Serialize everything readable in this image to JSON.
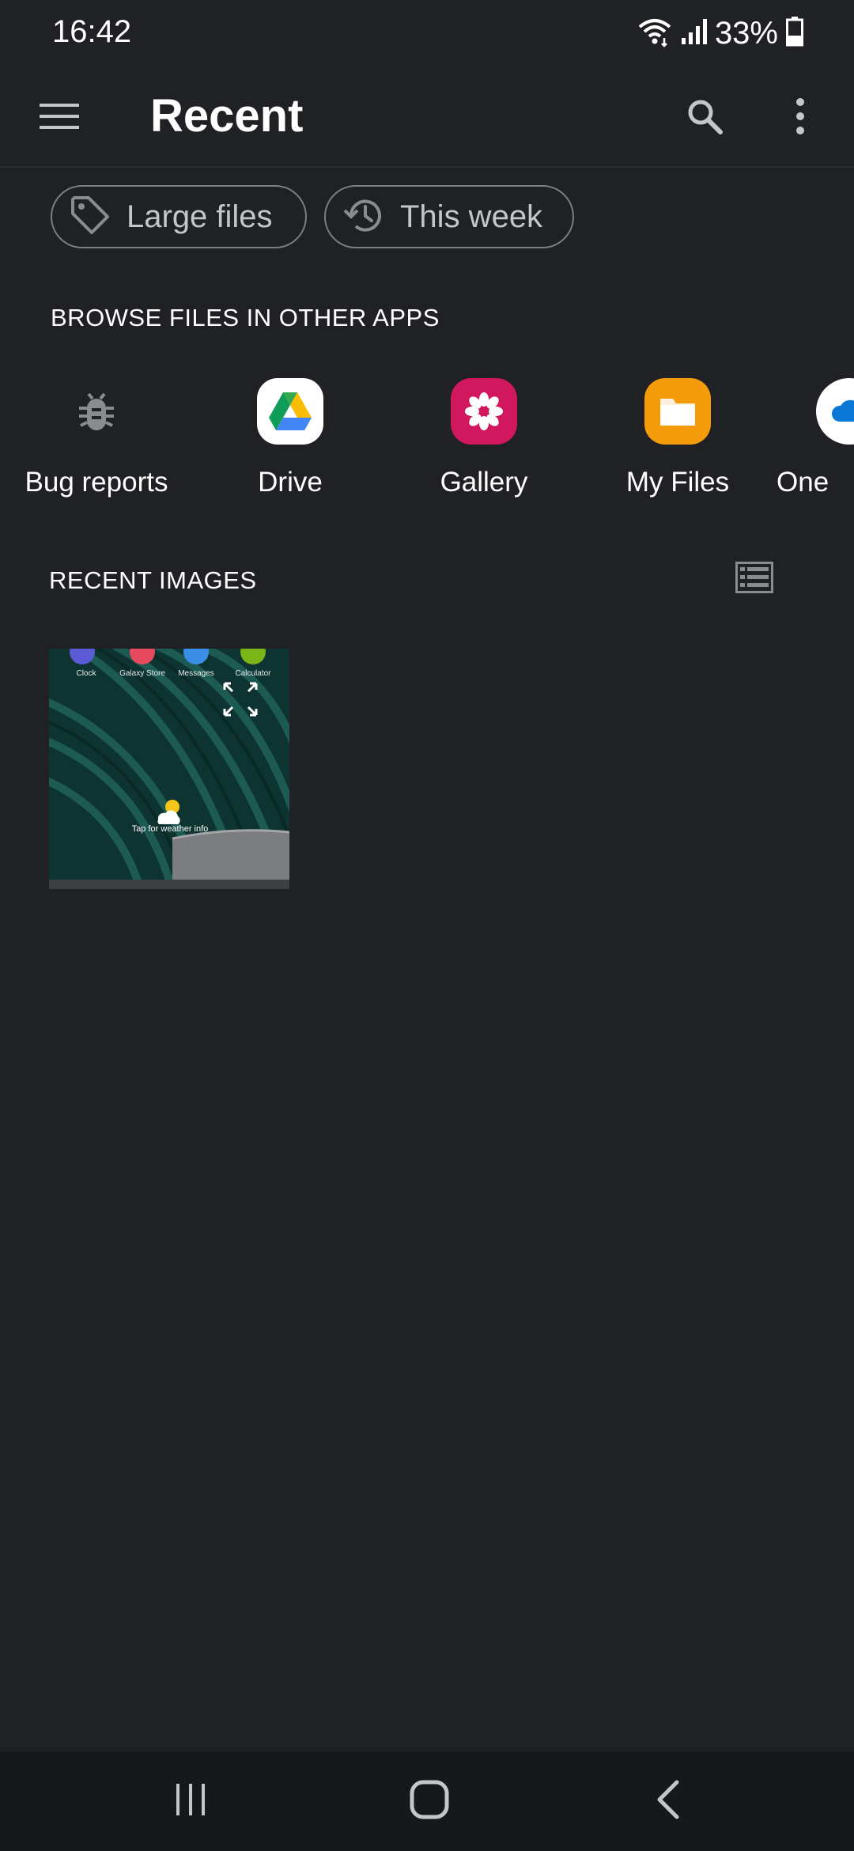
{
  "status_bar": {
    "time": "16:42",
    "battery_percent": "33%"
  },
  "app_bar": {
    "title": "Recent"
  },
  "filter_chips": [
    {
      "label": "Large files",
      "icon": "tag-icon"
    },
    {
      "label": "This week",
      "icon": "history-icon"
    }
  ],
  "browse_section": {
    "heading": "BROWSE FILES IN OTHER APPS",
    "apps": [
      {
        "label": "Bug reports",
        "icon": "bug-icon"
      },
      {
        "label": "Drive",
        "icon": "google-drive-icon"
      },
      {
        "label": "Gallery",
        "icon": "gallery-flower-icon",
        "color": "#d1175e"
      },
      {
        "label": "My Files",
        "icon": "folder-icon",
        "color": "#f59b0a"
      },
      {
        "label": "One",
        "icon": "onedrive-icon"
      }
    ]
  },
  "recent_images": {
    "heading": "RECENT IMAGES",
    "thumbnail": {
      "app_labels": [
        "Clock",
        "Galaxy Store",
        "Messages",
        "Calculator"
      ],
      "weather_text": "Tap for weather info"
    }
  },
  "colors": {
    "background": "#202124",
    "nav_background": "#17181b",
    "chip_border": "#7d7f83"
  }
}
